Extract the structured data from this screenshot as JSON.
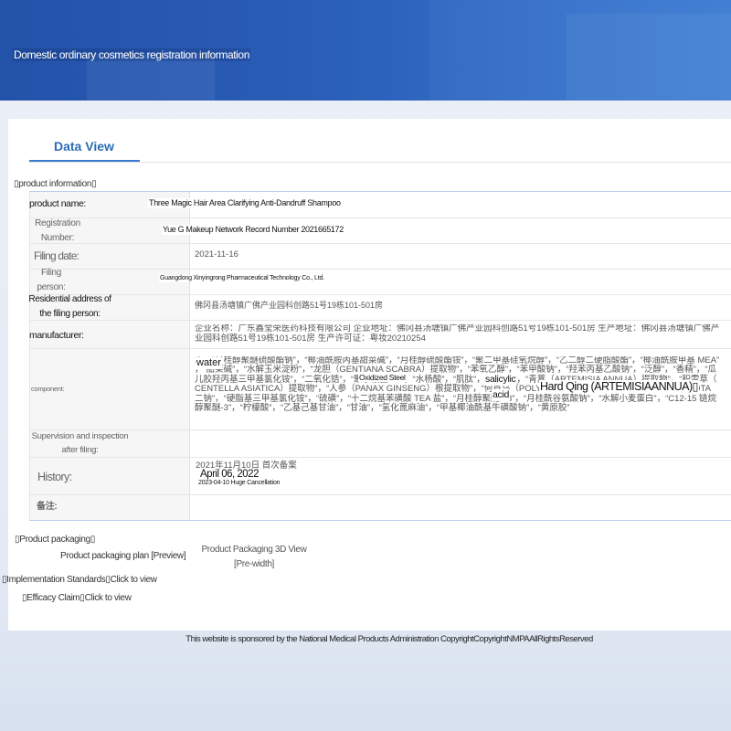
{
  "header": {
    "title": "Domestic ordinary cosmetics registration information"
  },
  "tabs": [
    {
      "label": "Data View",
      "active": true
    }
  ],
  "product_info": {
    "section_title": "▯product information▯",
    "product_name": {
      "label": "product name:",
      "value": "Three Magic Hair Area Clarifying Anti-Dandruff Shampoo"
    },
    "registration_number": {
      "label": [
        "Registration",
        "Number:"
      ],
      "value": "Yue G Makeup Network Record Number 2021665172"
    },
    "filing_date": {
      "label": "Filing date:",
      "value": "2021-11-16"
    },
    "filing_person": {
      "label": [
        "Filing",
        "person:"
      ],
      "value": "Guangdong Xinyingrong Pharmaceutical Technology Co., Ltd."
    },
    "filing_address": {
      "label": [
        "Residential address of",
        "the filing person:"
      ],
      "value": "佛冈县汤塘镇广佛产业园科创路51号19栋101-501房"
    },
    "manufacturer": {
      "label": "manufacturer:",
      "value": "企业名称：广东鑫莹荣医药科技有限公司 企业地址：佛冈县汤塘镇广佛产业园科创路51号19栋101-501房 生产地址：佛冈县汤塘镇广佛产业园科创路51号19栋101-501房 生产许可证：粤妆20210254"
    },
    "component": {
      "label": "component:",
      "value": "水，“月桂醇聚醚硫酸酯钠”，“椰油酰胺丙基甜菜碱”，“月桂醇硫酸酯铵”，“聚二甲基硅氧烷醇”，“乙二醇二硬脂酸酯”，“椰油酰胺甲基 MEA”，“甜菜碱”，“水解玉米淀粉”，“龙胆（GENTIANA SCABRA）提取物”，“苯氧乙醇”，“苯甲酸钠”，“羟苯丙基乙酸钠”，“泛醇”，“香精”，“瓜儿胶羟丙基三甲基氯化铵”，“二氧化锆”，“聚季铵盐-10”，“水杨酸”，“肌肽”，“氯化钠”，“青蒿（ARTEMISIA ANNUA）提取物”，“积雪草（CENTELLA ASIATICA）提取物”，“人参（PANAX GINSENG）根提取物”，“何首乌（POLYGONUM MULTIFLORUM）提取物”，“EDTA 二钠”，“硬脂基三甲基氯化铵”，“硫磺”，“十二烷基苯磺酸 TEA 盐”，“月桂醇聚醚-23”，“月桂酰谷氨酸钠”，“水解小麦蛋白”，“C12-15 链烷醇聚醚-3”，“柠檬酸”，“乙基己基甘油”，“甘油”，“氢化蓖麻油”，“甲基椰油酰基牛磺酸钠”，“黄原胶”",
      "translations": [
        "water",
        "Oxidized Steel",
        "salicylic",
        "acid",
        "Hard Qing (ARTEMISIAANNUA)▯"
      ]
    },
    "supervision": {
      "label": [
        "Supervision and inspection",
        "after filing:"
      ],
      "value": ""
    },
    "history": {
      "label": "History:",
      "value": "2021年11月10日 首次备案",
      "translations": [
        "April 06, 2022",
        "2023-04-10 Huge Cancellation"
      ]
    },
    "remarks": {
      "label": "备注:",
      "value": ""
    }
  },
  "product_packaging": {
    "section_title": "▯Product packaging▯",
    "plan_link": "Product packaging plan [Preview]",
    "view_3d_link": [
      "Product Packaging 3D View",
      "[Pre-width]"
    ]
  },
  "implementation_standards": {
    "label": "▯Implementation Standards▯",
    "link": "Click to view"
  },
  "efficacy_claim": {
    "label": "▯Efficacy Claim▯",
    "link": "Click to view"
  },
  "footer": {
    "text": "This website is sponsored by the National Medical Products Administration CopyrightCopyrightNMPAAllRightsReserved"
  },
  "colors": {
    "banner": "#2a5eb9",
    "accent": "#2b6cb5",
    "label_background": "#f6f6f6",
    "table_border": "#b9cde9"
  }
}
